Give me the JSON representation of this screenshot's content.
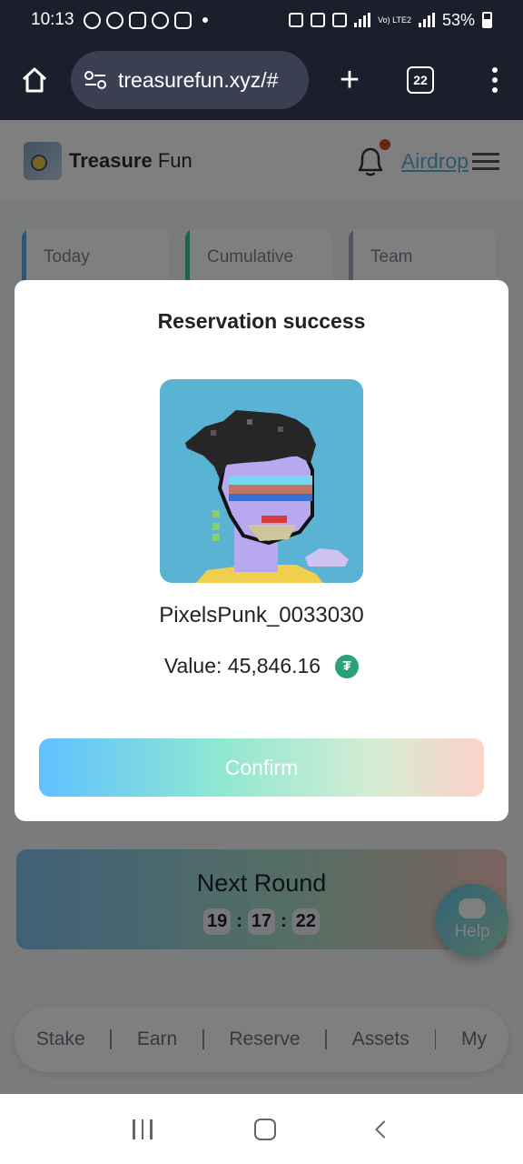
{
  "status_bar": {
    "time": "10:13",
    "network": "Vo) LTE2",
    "battery": "53%"
  },
  "browser": {
    "url": "treasurefun.xyz/#",
    "tab_count": "22"
  },
  "header": {
    "brand_bold": "Treasure",
    "brand_light": "Fun",
    "airdrop_link": "Airdrop"
  },
  "stat_cards": [
    {
      "label": "Today"
    },
    {
      "label": "Cumulative"
    },
    {
      "label": "Team"
    }
  ],
  "next_round": {
    "title": "Next Round",
    "hours": "19",
    "minutes": "17",
    "seconds": "22"
  },
  "help": {
    "label": "Help"
  },
  "bottom_nav": [
    "Stake",
    "Earn",
    "Reserve",
    "Assets",
    "My"
  ],
  "modal": {
    "title": "Reservation success",
    "nft_name": "PixelsPunk_0033030",
    "value_label": "Value: 45,846.16",
    "currency_icon": "tether-usdt-icon",
    "confirm_label": "Confirm"
  },
  "colors": {
    "nft_background": "#5ab3d3",
    "confirm_gradient_start": "#5fc1ff",
    "confirm_gradient_end": "#fbd3c8",
    "usdt_green": "#28a17c"
  }
}
